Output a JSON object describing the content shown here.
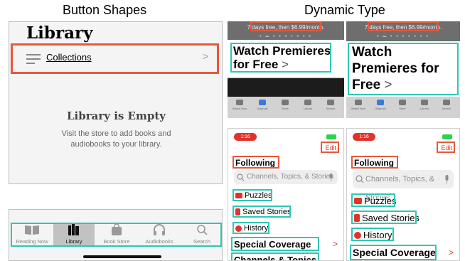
{
  "headings": {
    "left": "Button Shapes",
    "right": "Dynamic Type"
  },
  "library": {
    "title": "Library",
    "collections": "Collections",
    "chevron": ">",
    "empty_title": "Library is Empty",
    "empty_line1": "Visit the store to add books and",
    "empty_line2": "audiobooks to your library."
  },
  "tabbar": {
    "tabs": [
      "Reading Now",
      "Library",
      "Book Store",
      "Audiobooks",
      "Search"
    ],
    "selected": "Library"
  },
  "store": {
    "trial": "7 days free, then $6.99/month.",
    "dots": "● ▬ ● ● ● ● ● ● ●",
    "promo_line1": "Watch Premieres",
    "promo_line2": "for Free",
    "promo_line_a": "Watch",
    "promo_line_b": "Premieres for",
    "promo_line_c": "Free",
    "promo_arrow": ">",
    "tabs": [
      "Watch Now",
      "Originals",
      "Store",
      "Library",
      "Search"
    ]
  },
  "news": {
    "time": "1:16",
    "edit": "Edit",
    "following": "Following",
    "search_placeholder": "Channels, Topics, & Stories",
    "items": [
      "Puzzles",
      "Saved Stories",
      "History"
    ],
    "special": "Special Coverage",
    "channels": "Channels & Topics",
    "chevron": ">"
  },
  "colors": {
    "highlight_button_shapes": "#e8573a",
    "highlight_dynamic_type": "#2ec7b4",
    "news_accent": "#e0332c"
  }
}
